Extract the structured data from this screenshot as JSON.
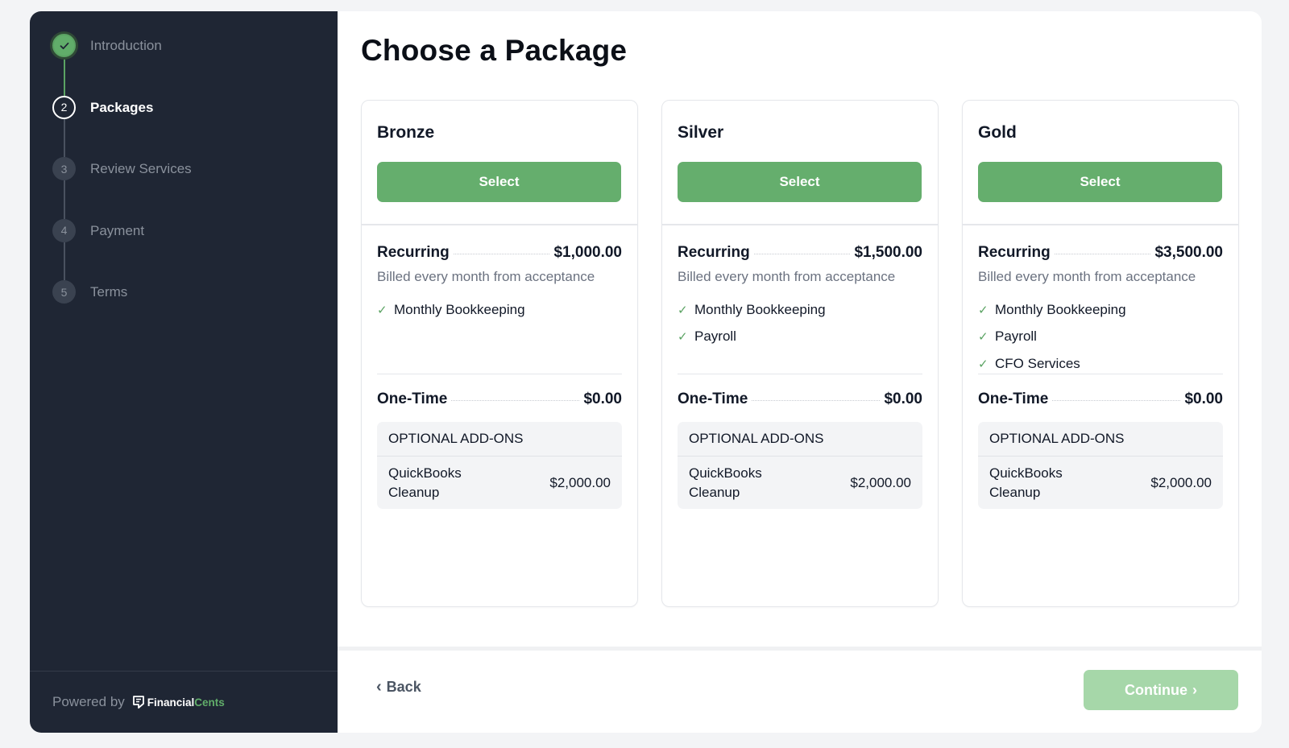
{
  "steps": [
    {
      "number": "",
      "label": "Introduction",
      "state": "done"
    },
    {
      "number": "2",
      "label": "Packages",
      "state": "current"
    },
    {
      "number": "3",
      "label": "Review Services",
      "state": "future"
    },
    {
      "number": "4",
      "label": "Payment",
      "state": "future"
    },
    {
      "number": "5",
      "label": "Terms",
      "state": "future"
    }
  ],
  "footer": {
    "powered": "Powered by",
    "brand_a": "Financial",
    "brand_b": "Cents"
  },
  "page": {
    "title": "Choose a Package"
  },
  "packages": [
    {
      "name": "Bronze",
      "select_label": "Select",
      "recurring_label": "Recurring",
      "recurring_price": "$1,000.00",
      "billed": "Billed every month from acceptance",
      "features": [
        "Monthly Bookkeeping"
      ],
      "onetime_label": "One-Time",
      "onetime_price": "$0.00",
      "addons_title": "OPTIONAL ADD-ONS",
      "addons": [
        {
          "name": "QuickBooks Cleanup",
          "price": "$2,000.00"
        }
      ]
    },
    {
      "name": "Silver",
      "select_label": "Select",
      "recurring_label": "Recurring",
      "recurring_price": "$1,500.00",
      "billed": "Billed every month from acceptance",
      "features": [
        "Monthly Bookkeeping",
        "Payroll"
      ],
      "onetime_label": "One-Time",
      "onetime_price": "$0.00",
      "addons_title": "OPTIONAL ADD-ONS",
      "addons": [
        {
          "name": "QuickBooks Cleanup",
          "price": "$2,000.00"
        }
      ]
    },
    {
      "name": "Gold",
      "select_label": "Select",
      "recurring_label": "Recurring",
      "recurring_price": "$3,500.00",
      "billed": "Billed every month from acceptance",
      "features": [
        "Monthly Bookkeeping",
        "Payroll",
        "CFO Services"
      ],
      "onetime_label": "One-Time",
      "onetime_price": "$0.00",
      "addons_title": "OPTIONAL ADD-ONS",
      "addons": [
        {
          "name": "QuickBooks Cleanup",
          "price": "$2,000.00"
        }
      ]
    }
  ],
  "nav": {
    "back_label": "Back",
    "continue_label": "Continue"
  },
  "colors": {
    "sidebar": "#1f2634",
    "accent": "#65ae6d",
    "accent_disabled": "#a6d7a9"
  },
  "icons": {
    "step_done": "check-icon",
    "feature": "check-icon",
    "back": "chevron-left-icon",
    "continue": "chevron-right-icon"
  }
}
